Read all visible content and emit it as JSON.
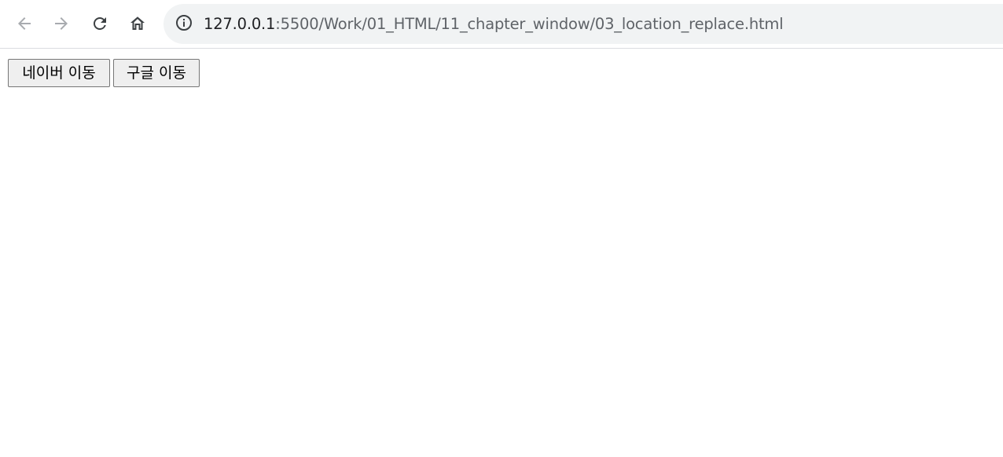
{
  "browser": {
    "nav": {
      "back_icon": "arrow-left-icon",
      "forward_icon": "arrow-right-icon",
      "reload_icon": "reload-icon",
      "home_icon": "home-icon"
    },
    "address_bar": {
      "site_info_icon": "info-circle-icon",
      "host": "127.0.0.1",
      "path": ":5500/Work/01_HTML/11_chapter_window/03_location_replace.html"
    }
  },
  "page": {
    "buttons": [
      {
        "label": "네이버 이동"
      },
      {
        "label": "구글 이동"
      }
    ]
  },
  "colors": {
    "toolbar_bg": "#ffffff",
    "omnibox_bg": "#f1f3f4",
    "icon_active": "#5f6368",
    "icon_disabled": "#a8abaf",
    "button_bg": "#efefef",
    "button_border": "#767676"
  }
}
